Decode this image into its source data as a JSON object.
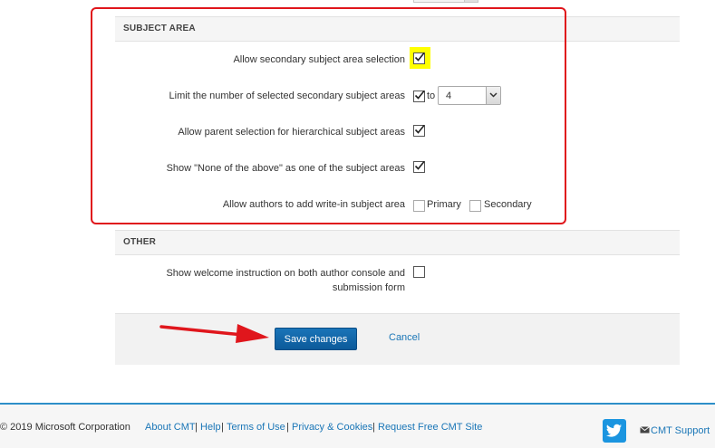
{
  "subject_area": {
    "title": "SUBJECT AREA",
    "rows": [
      {
        "label": "Allow secondary subject area selection",
        "checked": true,
        "highlighted": true
      },
      {
        "label": "Limit the number of selected secondary subject areas",
        "checked": true,
        "to_label": "to",
        "limit_value": "4"
      },
      {
        "label": "Allow parent selection for hierarchical subject areas",
        "checked": true
      },
      {
        "label": "Show \"None of the above\" as one of the subject areas",
        "checked": true
      },
      {
        "label": "Allow authors to add write-in subject area",
        "primary_label": "Primary",
        "primary_checked": false,
        "secondary_label": "Secondary",
        "secondary_checked": false
      }
    ]
  },
  "other": {
    "title": "OTHER",
    "welcome_label_line1": "Show welcome instruction on both author console and",
    "welcome_label_line2": "submission form",
    "welcome_checked": false
  },
  "actions": {
    "save_label": "Save changes",
    "cancel_label": "Cancel"
  },
  "footer": {
    "copyright": "© 2019 Microsoft Corporation",
    "links": [
      "About CMT",
      "Help",
      "Terms of Use",
      "Privacy & Cookies",
      "Request Free CMT Site"
    ],
    "separator": "|",
    "support_label": "CMT Support"
  },
  "colors": {
    "annotation_red": "#e0161c",
    "highlight_yellow": "#ffff00",
    "primary_button": "#0c5a9a",
    "link": "#1a76b7",
    "footer_accent": "#2d8fc9",
    "twitter": "#1b95e0"
  },
  "icons": [
    "checkmark-icon",
    "chevron-down-icon",
    "red-arrow-annotation",
    "twitter-icon",
    "mail-icon"
  ]
}
